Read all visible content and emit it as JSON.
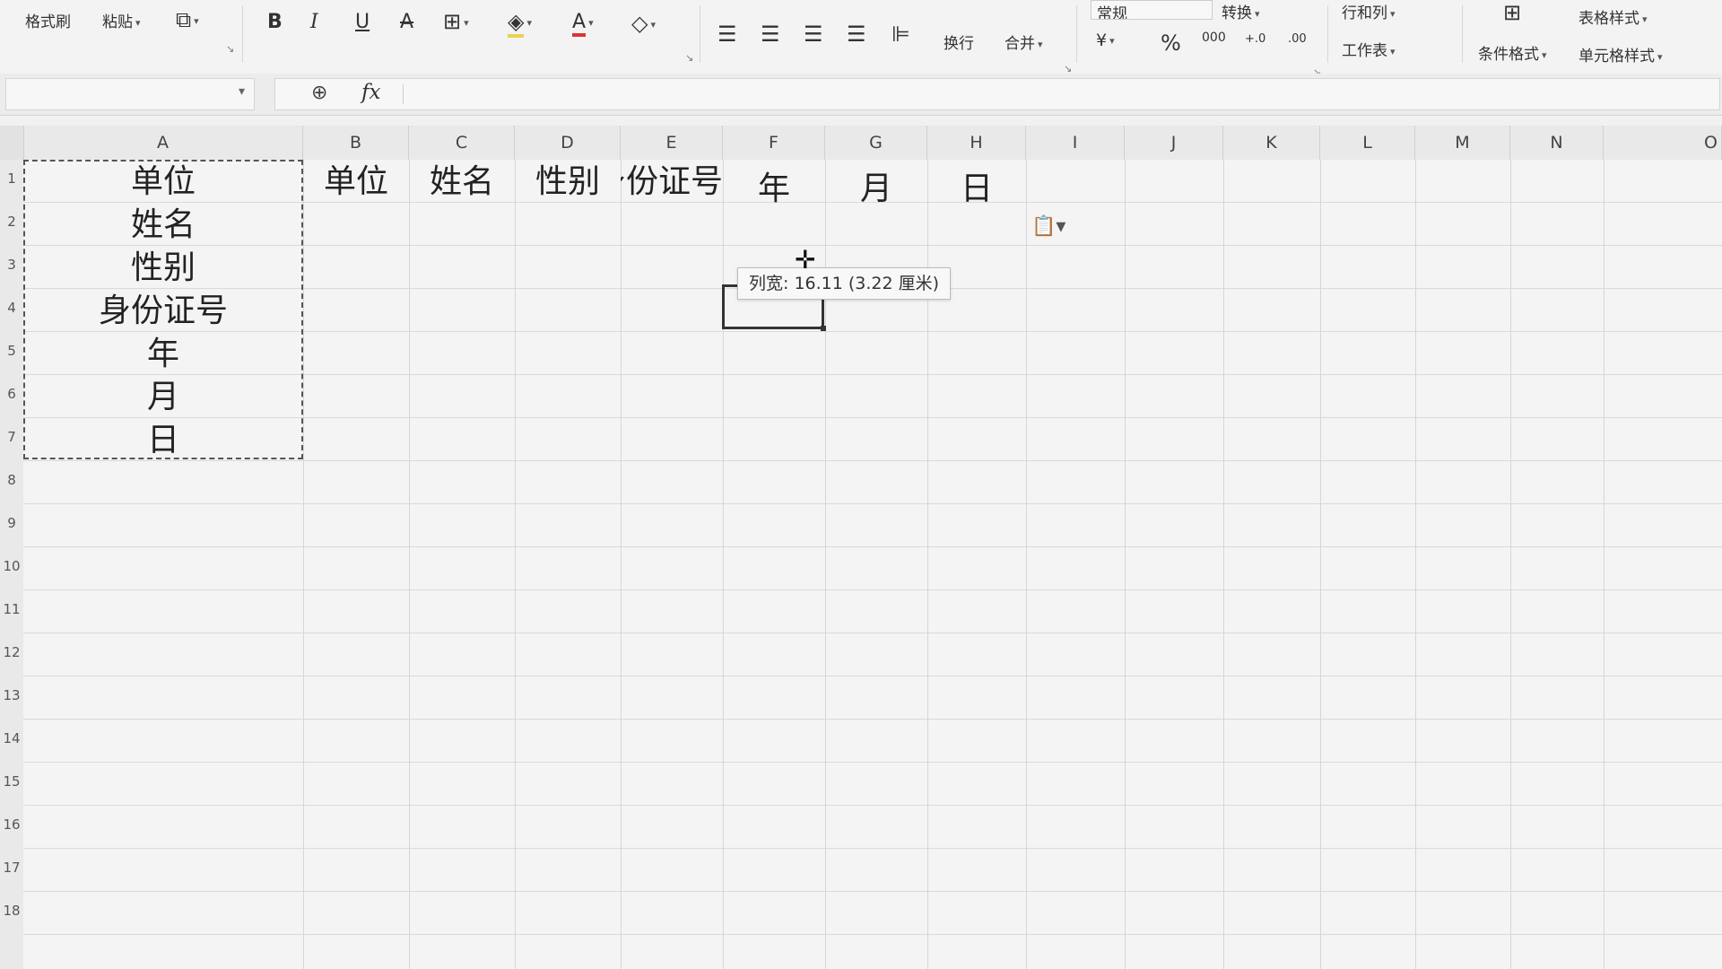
{
  "ribbon": {
    "format_painter": "格式刷",
    "paste": "粘贴",
    "copy_menu": "",
    "bold": "B",
    "italic": "I",
    "underline": "U",
    "strikethrough": "A",
    "font_color": "A",
    "wrap_text": "换行",
    "merge": "合并",
    "number_format_value": "常规",
    "convert": "转换",
    "rows_cols": "行和列",
    "worksheet": "工作表",
    "conditional_format": "条件格式",
    "table_style": "表格样式",
    "cell_style": "单元格样式",
    "currency": "¥",
    "percent": "%",
    "thousands": "000",
    "inc_decimal": "+.0",
    "dec_decimal": ".00"
  },
  "formula_bar": {
    "name_box": "",
    "formula": ""
  },
  "columns": [
    "A",
    "B",
    "C",
    "D",
    "E",
    "F",
    "G",
    "H",
    "I",
    "J",
    "K",
    "L",
    "M",
    "N",
    "O"
  ],
  "rows": [
    "1",
    "2",
    "3",
    "4",
    "5",
    "6",
    "7",
    "8",
    "9",
    "10",
    "11",
    "12",
    "13",
    "14",
    "15",
    "16",
    "17",
    "18"
  ],
  "cells": {
    "A1": "单位",
    "A2": "姓名",
    "A3": "性别",
    "A4": "身份证号",
    "A5": "年",
    "A6": "月",
    "A7": "日",
    "B1": "单位",
    "C1": "姓名",
    "D1": "性别",
    "E1": "身份证号",
    "F1": "年",
    "G1": "月",
    "H1": "日"
  },
  "tooltip": "列宽: 16.11 (3.22 厘米)"
}
